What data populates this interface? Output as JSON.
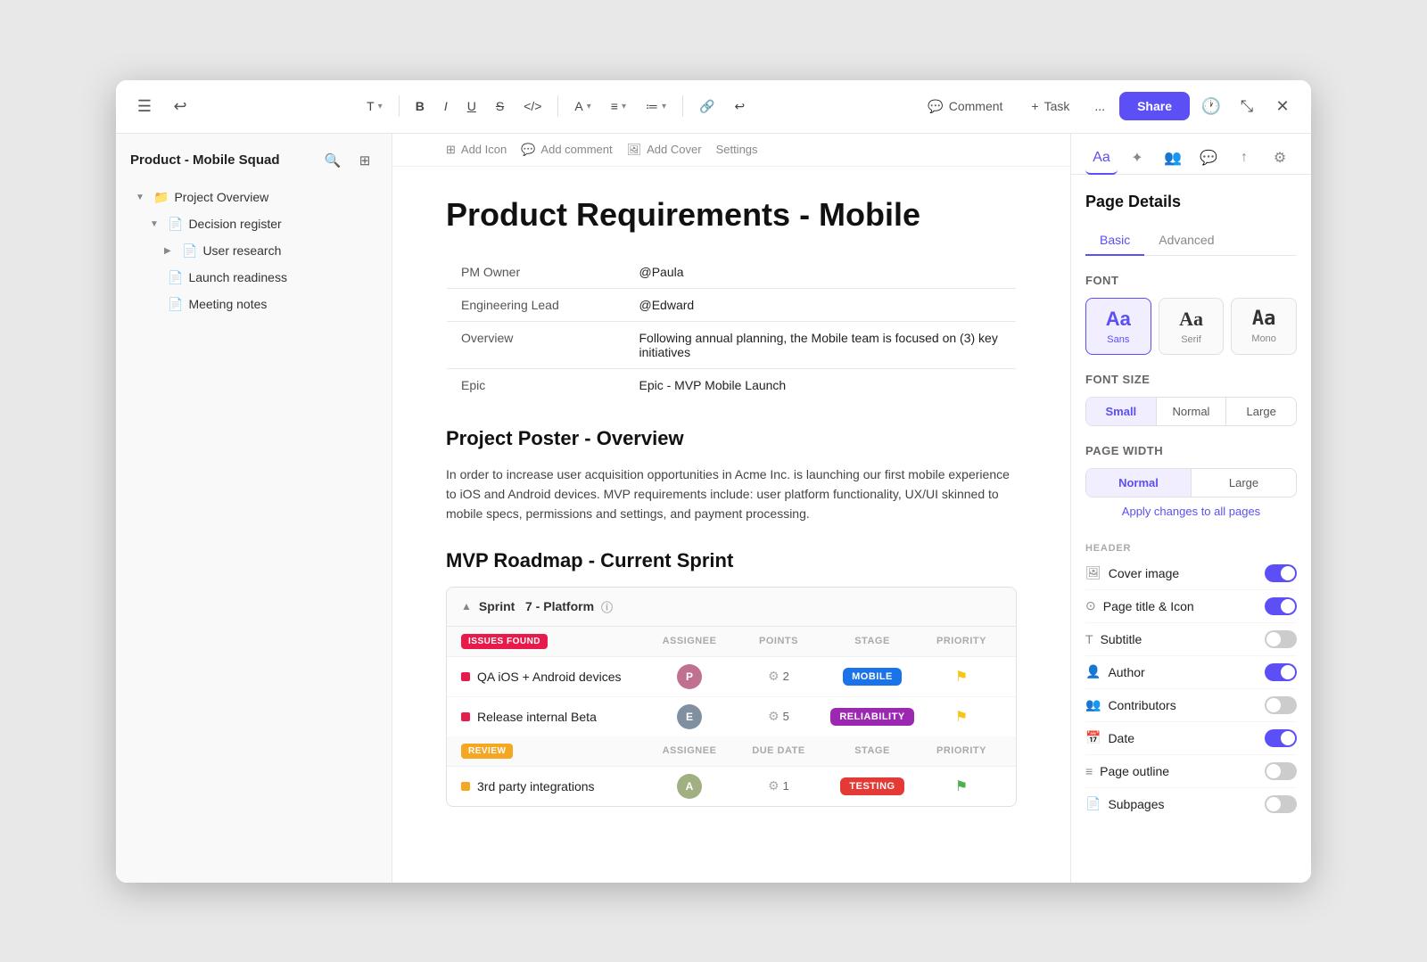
{
  "window": {
    "title": "Product - Mobile Squad"
  },
  "toolbar": {
    "text_label": "T",
    "bold_label": "B",
    "italic_label": "I",
    "underline_label": "U",
    "strikethrough_label": "S",
    "code_label": "</>",
    "font_color_label": "A",
    "align_label": "≡",
    "list_label": "≔",
    "link_label": "🔗",
    "loop_label": "↩",
    "comment_label": "Comment",
    "task_label": "Task",
    "more_label": "...",
    "share_label": "Share"
  },
  "sidebar": {
    "title": "Product - Mobile Squad",
    "project_overview": "Project Overview",
    "items": [
      {
        "label": "Decision register",
        "level": 1,
        "icon": "doc",
        "expanded": false
      },
      {
        "label": "User research",
        "level": 2,
        "icon": "doc",
        "expanded": false
      },
      {
        "label": "Launch readiness",
        "level": 1,
        "icon": "doc",
        "expanded": false
      },
      {
        "label": "Meeting notes",
        "level": 1,
        "icon": "doc",
        "expanded": false
      }
    ]
  },
  "page_toolbar": {
    "add_icon_label": "Add Icon",
    "add_comment_label": "Add comment",
    "add_cover_label": "Add Cover",
    "settings_label": "Settings"
  },
  "page": {
    "title": "Product Requirements - Mobile",
    "info_table": [
      {
        "label": "PM Owner",
        "value": "@Paula"
      },
      {
        "label": "Engineering Lead",
        "value": "@Edward"
      },
      {
        "label": "Overview",
        "value": "Following annual planning, the Mobile team is focused on (3) key initiatives"
      },
      {
        "label": "Epic",
        "value": "Epic - MVP Mobile Launch"
      }
    ],
    "section1": {
      "heading": "Project Poster - Overview",
      "text": "In order to increase user acquisition opportunities in Acme Inc. is launching our first mobile experience to iOS and Android devices. MVP requirements include: user platform functionality, UX/UI skinned to mobile specs, permissions and settings, and payment processing."
    },
    "section2": {
      "heading": "MVP Roadmap - Current Sprint",
      "sprint": {
        "name": "Sprint",
        "number": "7",
        "sub": "- Platform",
        "groups": [
          {
            "badge": "ISSUES FOUND",
            "badge_type": "issues",
            "columns": [
              "ASSIGNEE",
              "POINTS",
              "STAGE",
              "PRIORITY"
            ],
            "tasks": [
              {
                "name": "QA iOS + Android devices",
                "dot": "red",
                "assignee": "P",
                "points": 2,
                "stage": "MOBILE",
                "stage_type": "mobile",
                "priority": "yellow"
              },
              {
                "name": "Release internal Beta",
                "dot": "red",
                "assignee": "E",
                "points": 5,
                "stage": "RELIABILITY",
                "stage_type": "reliability",
                "priority": "yellow"
              }
            ]
          },
          {
            "badge": "REVIEW",
            "badge_type": "review",
            "columns": [
              "ASSIGNEE",
              "DUE DATE",
              "STAGE",
              "PRIORITY"
            ],
            "tasks": [
              {
                "name": "3rd party integrations",
                "dot": "yellow",
                "assignee": "A",
                "points": 1,
                "stage": "TESTING",
                "stage_type": "testing",
                "priority": "green"
              }
            ]
          }
        ]
      }
    }
  },
  "right_panel": {
    "section_title": "Page Details",
    "tabs": [
      "Basic",
      "Advanced"
    ],
    "active_tab": "Basic",
    "font": {
      "label": "Font",
      "options": [
        {
          "label": "Sans",
          "letter": "Aa",
          "style": "sans",
          "active": true
        },
        {
          "label": "Serif",
          "letter": "Aa",
          "style": "serif",
          "active": false
        },
        {
          "label": "Mono",
          "letter": "Aa",
          "style": "mono",
          "active": false
        }
      ]
    },
    "font_size": {
      "label": "Font Size",
      "options": [
        "Small",
        "Normal",
        "Large"
      ],
      "active": "Small"
    },
    "page_width": {
      "label": "Page Width",
      "options": [
        "Normal",
        "Large"
      ],
      "active": "Normal",
      "apply_label": "Apply changes to all pages"
    },
    "header": {
      "label": "HEADER",
      "items": [
        {
          "label": "Cover image",
          "icon": "🖼",
          "on": true
        },
        {
          "label": "Page title & Icon",
          "icon": "⊙",
          "on": true
        },
        {
          "label": "Subtitle",
          "icon": "T",
          "on": false
        },
        {
          "label": "Author",
          "icon": "👤",
          "on": true
        },
        {
          "label": "Contributors",
          "icon": "👥",
          "on": false
        },
        {
          "label": "Date",
          "icon": "📅",
          "on": true
        },
        {
          "label": "Page outline",
          "icon": "≡",
          "on": false
        },
        {
          "label": "Subpages",
          "icon": "📄",
          "on": false
        }
      ]
    }
  }
}
